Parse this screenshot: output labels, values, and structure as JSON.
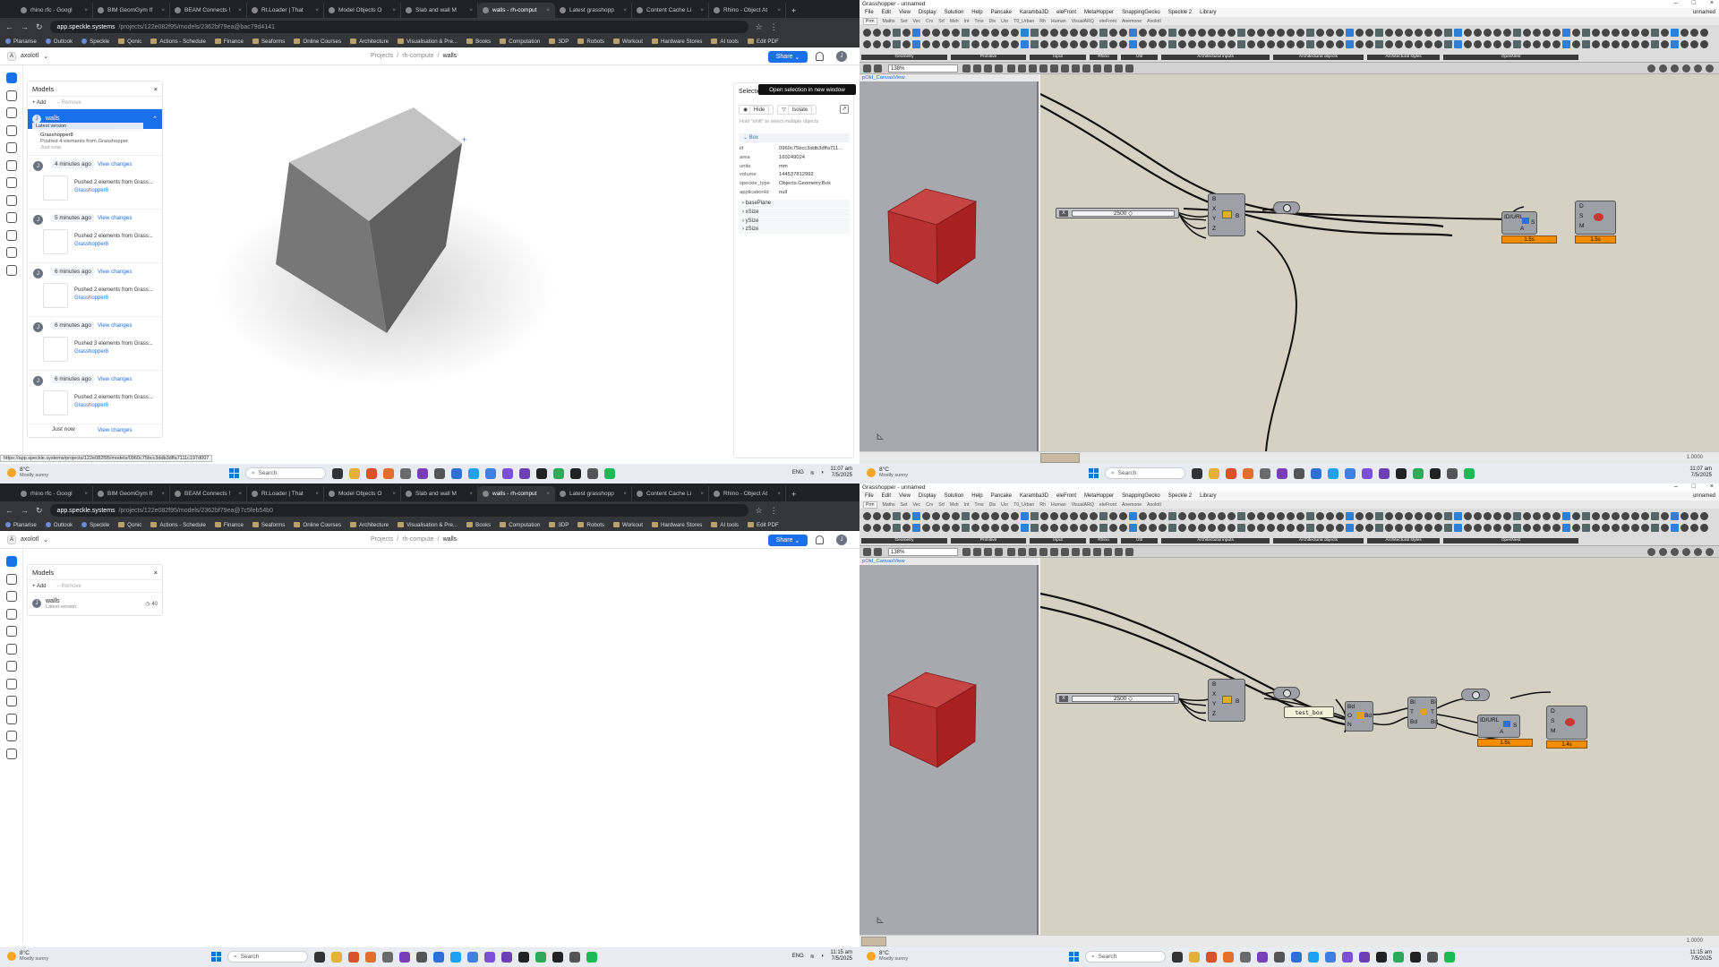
{
  "browser": {
    "tabs": [
      "rhino rfc - Googl",
      "BIM GeomGym If",
      "BEAM Connects !",
      "Rt.Loader | That",
      "Model Objects O",
      "Slab and wall M",
      "walls - rh-comput",
      "Latest grasshopp",
      "Content Cache Li",
      "Rhino - Object At"
    ],
    "active_tab_index": 6,
    "url_host": "app.speckle.systems",
    "url_path_top": "/projects/122e082f95/models/2362bf79ea@bac79d4141",
    "url_path_bottom": "/projects/122e082f95/models/2362bf79ea@7c5feb54b0",
    "bookmarks": [
      "Planarise",
      "Outlook",
      "Speckle",
      "Qonic",
      "Actions - Schedule",
      "Finance",
      "Seaforms",
      "Online Courses",
      "Architecture",
      "Visualisation & Pre...",
      "Books",
      "Computation",
      "3DP",
      "Robots",
      "Workout",
      "Hardware Stores",
      "AI tools",
      "Edit PDF"
    ]
  },
  "speckle": {
    "workspace": "axolotl",
    "breadcrumb": {
      "a": "Projects",
      "b": "rh-compute",
      "c": "walls"
    },
    "share_label": "Share",
    "user_initial": "J",
    "models_title": "Models",
    "add_label": "+ Add",
    "remove_label": "– Remove",
    "model_name": "walls",
    "model_sub": "Latest version",
    "model_desc_title": "Grasshopper8",
    "model_desc_msg": "Pushed 4 elements from Grasshopper.",
    "model_desc_time": "Just now",
    "bottom_model_count": "40",
    "versions": [
      {
        "time": "4 minutes ago",
        "link": "View changes",
        "msg": "Pushed 2 elements from Grass...",
        "src": "Grasshopper8"
      },
      {
        "time": "5 minutes ago",
        "link": "View changes",
        "msg": "Pushed 2 elements from Grass...",
        "src": "Grasshopper8"
      },
      {
        "time": "6 minutes ago",
        "link": "View changes",
        "msg": "Pushed 2 elements from Grass...",
        "src": "Grasshopper8"
      },
      {
        "time": "6 minutes ago",
        "link": "View changes",
        "msg": "Pushed 3 elements from Grass...",
        "src": "Grasshopper8"
      },
      {
        "time": "6 minutes ago",
        "link": "View changes",
        "msg": "Pushed 2 elements from Grass...",
        "src": "Grasshopper8"
      }
    ],
    "last_version_time": "Just now",
    "last_version_link": "View changes",
    "selection": {
      "title": "Selectio",
      "tooltip": "Open selection in new window",
      "hide": "Hide",
      "isolate": "Isolate",
      "hint": "Hold \"shift\" to select multiple objects",
      "box": "Box",
      "props": [
        {
          "k": "id",
          "v": "0960c75bcc3ddb3dffa711..."
        },
        {
          "k": "area",
          "v": "160249024"
        },
        {
          "k": "units",
          "v": "mm"
        },
        {
          "k": "volume",
          "v": "14453781299​2"
        },
        {
          "k": "speckle_type",
          "v": "Objects.Geometry.Box"
        },
        {
          "k": "applicationId",
          "v": "null"
        }
      ],
      "subs": [
        "basePlane",
        "xSize",
        "ySize",
        "zSize"
      ]
    },
    "status_url": "https://app.speckle.systems/projects/122e082f95/models/0960c75bcc3ddb3dffa7111c197d007"
  },
  "taskbar": {
    "temp": "8°C",
    "weather": "Mostly sunny",
    "search": "Search",
    "lang": "ENG",
    "time_top": "11:07 am",
    "date_top": "7/5/2025",
    "time_bottom": "11:15 am",
    "date_bottom": "7/5/2025"
  },
  "grasshopper": {
    "title": "Grasshopper - unnamed",
    "unnamed": "unnamed",
    "menu": [
      "File",
      "Edit",
      "View",
      "Display",
      "Solution",
      "Help",
      "Pancake",
      "Karamba3D",
      "eleFront",
      "MetaHopper",
      "SnappingGecko",
      "Speckle 2",
      "Library"
    ],
    "tabs": [
      "Prm",
      "Maths",
      "Set",
      "Vec",
      "Crv",
      "Srf",
      "Msh",
      "Int",
      "Trns",
      "Dis",
      "Usr",
      "T0_Urban",
      "Rh",
      "Human",
      "VisualARQ",
      "eleFront",
      "Anemone",
      "Axolotl"
    ],
    "groups": [
      "Geometry",
      "Primitive",
      "Input",
      "Rhino",
      "Util",
      "Architectural inputs",
      "Architectural objects",
      "Architectural styles",
      "OpenNest"
    ],
    "zoom": "138%",
    "canvas_view": "pOld_CanvasView",
    "slider_value": "2500",
    "slider_x": "X",
    "box_inputs": [
      "B",
      "X",
      "Y",
      "Z"
    ],
    "box_output": "B",
    "text_panel": "test_box",
    "idurl_label": "ID/URL",
    "idurl_pins": [
      "A",
      "S"
    ],
    "send_inputs": [
      "D",
      "S",
      "M"
    ],
    "timer_idurl_top": "1.5s",
    "timer_send_top": "1.5s",
    "timer_idurl_bottom": "1.5s",
    "timer_send_bottom": "1.4s",
    "bd_pins": [
      "Bd",
      "O",
      "N"
    ],
    "bd_out": "Bd",
    "t_pins": [
      "Bi",
      "T",
      "Bd"
    ],
    "t_out": [
      "Bi",
      "T",
      "Bd"
    ],
    "zoom_level": "1.0000"
  }
}
